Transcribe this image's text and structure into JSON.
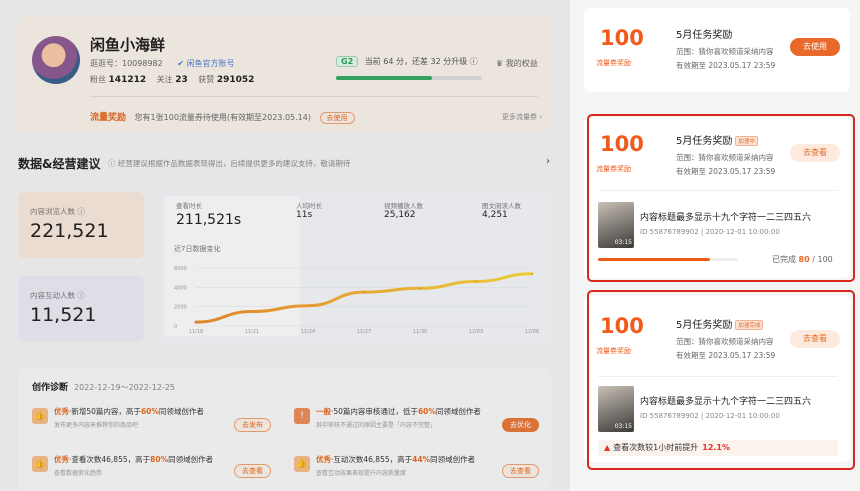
{
  "profile": {
    "name": "闲鱼小海鲜",
    "id_text": "逛逛号：10098982",
    "verified": "闲鱼官方账号",
    "fans_label": "粉丝",
    "fans_value": "141212",
    "follow_label": "关注",
    "follow_value": "23",
    "likes_label": "获赞",
    "likes_value": "291052",
    "level_badge": "G2",
    "level_text": "当前 64 分，还差 32 分升级",
    "level_progress": 0.66,
    "rights": "我的权益",
    "flow_title": "流量奖励",
    "flow_text": "您有1张100流量券待使用(有效期至2023.05.14)",
    "flow_button": "去使用",
    "more_coupons": "更多流量券 ›"
  },
  "section": {
    "title": "数据&经营建议",
    "note": "经营建议根据作品数据表现得出，后续提供更多的建议支持，敬请期待",
    "arrow": "›"
  },
  "metrics": {
    "browse_label": "内容浏览人数",
    "browse_value": "221,521",
    "interact_label": "内容互动人数",
    "interact_value": "11,521",
    "watch_label": "查看时长",
    "watch_value": "211,521s",
    "avg_label": "人均时长",
    "avg_value": "11s",
    "play_label": "视频播放人数",
    "play_value": "25,162",
    "read_label": "图文阅读人数",
    "read_value": "4,251",
    "trend_label": "近7日数据变化"
  },
  "chart_data": {
    "type": "line",
    "x": [
      "11/18",
      "11/21",
      "11/24",
      "11/27",
      "11/30",
      "12/03",
      "12/06"
    ],
    "yticks": [
      "6000",
      "4000",
      "2000",
      "0"
    ],
    "values": [
      400,
      1500,
      2100,
      3500,
      3900,
      4600,
      5400
    ],
    "ylim": [
      0,
      6000
    ]
  },
  "diagnosis": {
    "title": "创作诊断",
    "range": "2022-12-19～2022-12-25",
    "items": [
      {
        "tag": "优秀",
        "text_a": "·新增50篇内容，高于",
        "pct": "60%",
        "text_b": "同领域创作者",
        "sub": "发布更多内容来推荐你的商品吧",
        "button": "去发布"
      },
      {
        "tag": "一般",
        "text_a": "·50篇内容审核通过，低于",
        "pct": "60%",
        "text_b": "同领域创作者",
        "sub": "其中审核不通过的原因主要是「内容不完整」",
        "button": "去优化"
      },
      {
        "tag": "优秀",
        "text_a": "·查看次数46,855，高于",
        "pct": "80%",
        "text_b": "同领域创作者",
        "sub": "查看数据变化趋势",
        "button": "去查看"
      },
      {
        "tag": "优秀",
        "text_a": "·互动次数46,855，高于",
        "pct": "44%",
        "text_b": "同领域创作者",
        "sub": "查看互动效果表现提升内容质量度",
        "button": "去查看"
      }
    ]
  },
  "rewards": [
    {
      "amount": "100",
      "unit": "流量券奖励",
      "title": "5月任务奖励",
      "tag": "",
      "range": "范围：猜你喜欢频道采纳内容",
      "expire": "有效期至 2023.05.17 23:59",
      "button": "去使用"
    },
    {
      "amount": "100",
      "unit": "流量券奖励",
      "title": "5月任务奖励",
      "tag": "加速中",
      "range": "范围：猜你喜欢频道采纳内容",
      "expire": "有效期至 2023.05.17 23:59",
      "button": "去查看",
      "video_title": "内容标题最多显示十九个字符一二三四五六",
      "video_meta": "ID 55876789902 | 2020-12-01 10:00:00",
      "duration": "03:15",
      "progress_label": "已完成",
      "progress_done": "80",
      "progress_total": "/ 100",
      "progress": 0.8
    },
    {
      "amount": "100",
      "unit": "流量券奖励",
      "title": "5月任务奖励",
      "tag": "加速完成",
      "range": "范围：猜你喜欢频道采纳内容",
      "expire": "有效期至 2023.05.17 23:59",
      "button": "去查看",
      "video_title": "内容标题最多显示十九个字符一二三四五六",
      "video_meta": "ID 55876789902 | 2020-12-01 10:00:00",
      "duration": "03:15",
      "rise_text": "查看次数较1小时前提升",
      "rise_value": "12.1%"
    }
  ]
}
